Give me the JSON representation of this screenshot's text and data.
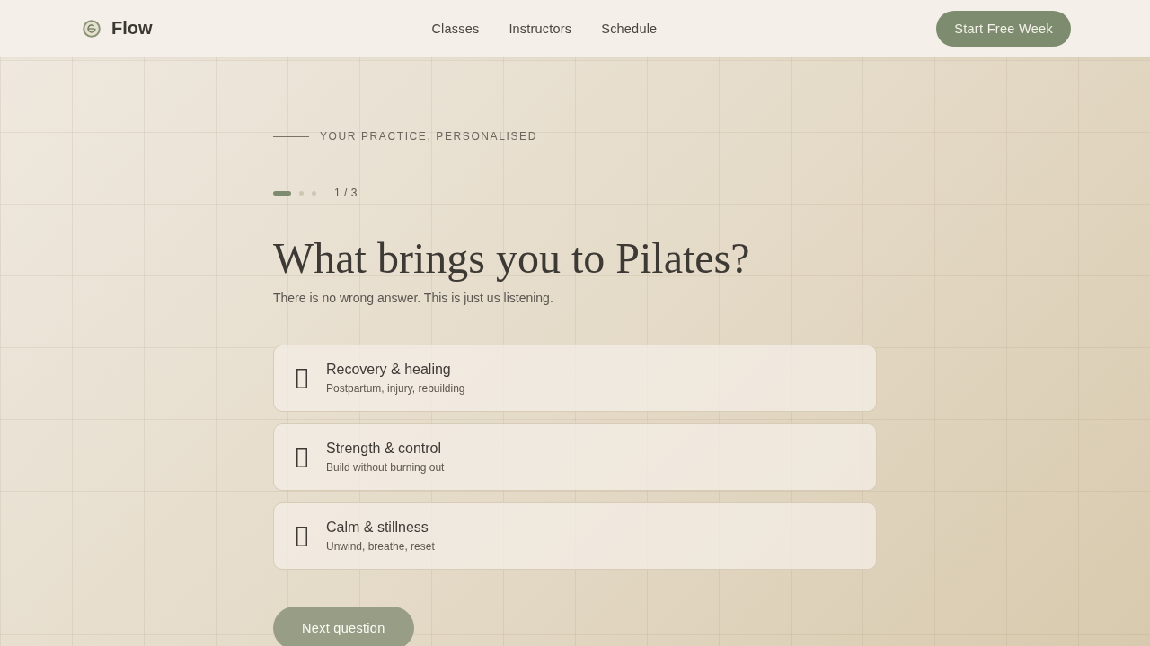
{
  "header": {
    "brand": "Flow",
    "nav": [
      "Classes",
      "Instructors",
      "Schedule"
    ],
    "cta": "Start Free Week"
  },
  "quiz": {
    "eyebrow": "YOUR PRACTICE, PERSONALISED",
    "steps": [
      {
        "current": true
      },
      {
        "current": false
      },
      {
        "current": false
      }
    ],
    "step_label": "1 / 3",
    "title": "What brings you to Pilates?",
    "subtitle": "There is no wrong answer. This is just us listening.",
    "options": [
      {
        "title": "Recovery & healing",
        "description": "Postpartum, injury, rebuilding",
        "selected": false
      },
      {
        "title": "Strength & control",
        "description": "Build without burning out",
        "selected": false
      },
      {
        "title": "Calm & stillness",
        "description": "Unwind, breathe, reset",
        "selected": false
      }
    ],
    "next_button": {
      "label": "Next question",
      "disabled": true
    }
  }
}
